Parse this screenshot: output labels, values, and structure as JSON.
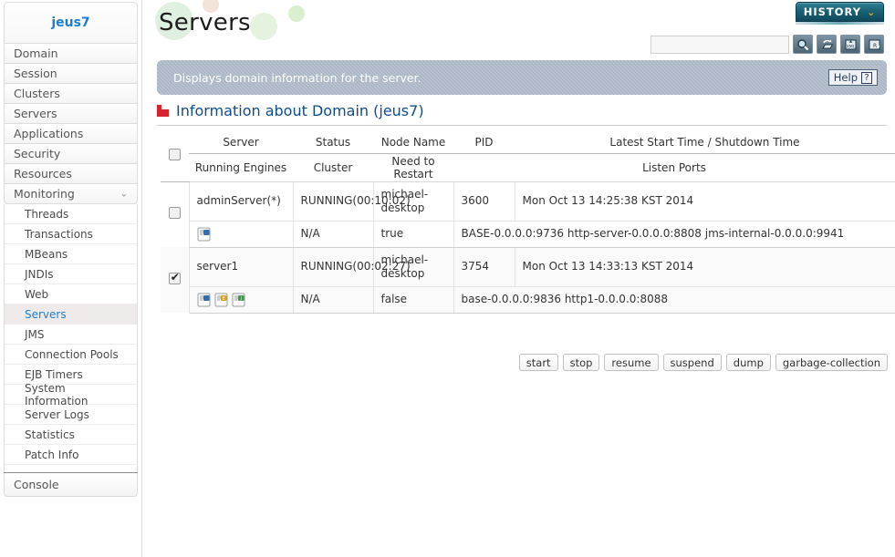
{
  "sidebar": {
    "brand": "jeus7",
    "top_items": [
      {
        "label": "Domain",
        "expandable": false
      },
      {
        "label": "Session",
        "expandable": false
      },
      {
        "label": "Clusters",
        "expandable": false
      },
      {
        "label": "Servers",
        "expandable": false
      },
      {
        "label": "Applications",
        "expandable": false
      },
      {
        "label": "Security",
        "expandable": false
      },
      {
        "label": "Resources",
        "expandable": false
      },
      {
        "label": "Monitoring",
        "expandable": true,
        "chevron": "⌄"
      }
    ],
    "sub_items": [
      {
        "label": "Threads",
        "active": false
      },
      {
        "label": "Transactions",
        "active": false
      },
      {
        "label": "MBeans",
        "active": false
      },
      {
        "label": "JNDIs",
        "active": false
      },
      {
        "label": "Web",
        "active": false
      },
      {
        "label": "Servers",
        "active": true
      },
      {
        "label": "JMS",
        "active": false
      },
      {
        "label": "Connection Pools",
        "active": false
      },
      {
        "label": "EJB Timers",
        "active": false
      },
      {
        "label": "System Information",
        "active": false
      },
      {
        "label": "Server Logs",
        "active": false
      },
      {
        "label": "Statistics",
        "active": false
      },
      {
        "label": "Patch Info",
        "active": false
      }
    ],
    "footer_item": "Console"
  },
  "header": {
    "page_title": "Servers",
    "history_label": "HISTORY",
    "history_chevron": "⌄",
    "search_value": "",
    "search_placeholder": "",
    "tool_icons": [
      "search-icon",
      "refresh-icon",
      "export-xml-icon",
      "export-report-icon"
    ]
  },
  "banner": {
    "message": "Displays domain information for the server.",
    "help_label": "Help",
    "help_mark": "?"
  },
  "section": {
    "title": "Information about Domain (jeus7)"
  },
  "table": {
    "header_row1": [
      "Server",
      "Status",
      "Node Name",
      "PID",
      "Latest Start Time / Shutdown Time"
    ],
    "header_row2": [
      "Running Engines",
      "Cluster",
      "Need to Restart",
      "Listen Ports"
    ],
    "rows": [
      {
        "selected": false,
        "server": "adminServer(*)",
        "status": "RUNNING(00:10:02)",
        "node_name": "michael-desktop",
        "pid": "3600",
        "latest_start_time": "Mon Oct 13 14:25:38 KST 2014",
        "engines": [
          "base-engine-icon"
        ],
        "cluster": "N/A",
        "need_to_restart": "true",
        "listen_ports": "BASE-0.0.0.0:9736 http-server-0.0.0.0:8808 jms-internal-0.0.0.0:9941"
      },
      {
        "selected": true,
        "server": "server1",
        "status": "RUNNING(00:02:27)",
        "node_name": "michael-desktop",
        "pid": "3754",
        "latest_start_time": "Mon Oct 13 14:33:13 KST 2014",
        "engines": [
          "base-engine-icon",
          "ejb-engine-icon",
          "jms-engine-icon"
        ],
        "cluster": "N/A",
        "need_to_restart": "false",
        "listen_ports": "base-0.0.0.0:9836 http1-0.0.0.0:8088"
      }
    ]
  },
  "actions": [
    {
      "label": "start"
    },
    {
      "label": "stop"
    },
    {
      "label": "resume"
    },
    {
      "label": "suspend"
    },
    {
      "label": "dump"
    },
    {
      "label": "garbage-collection"
    }
  ],
  "colors": {
    "brand_blue": "#1a7fd4",
    "section_blue": "#0f4c8a",
    "banner_gray": "#aab6c4",
    "history_teal": "#195f72",
    "history_chevron_orange": "#f0a71e",
    "section_icon_red": "#d9232e"
  }
}
